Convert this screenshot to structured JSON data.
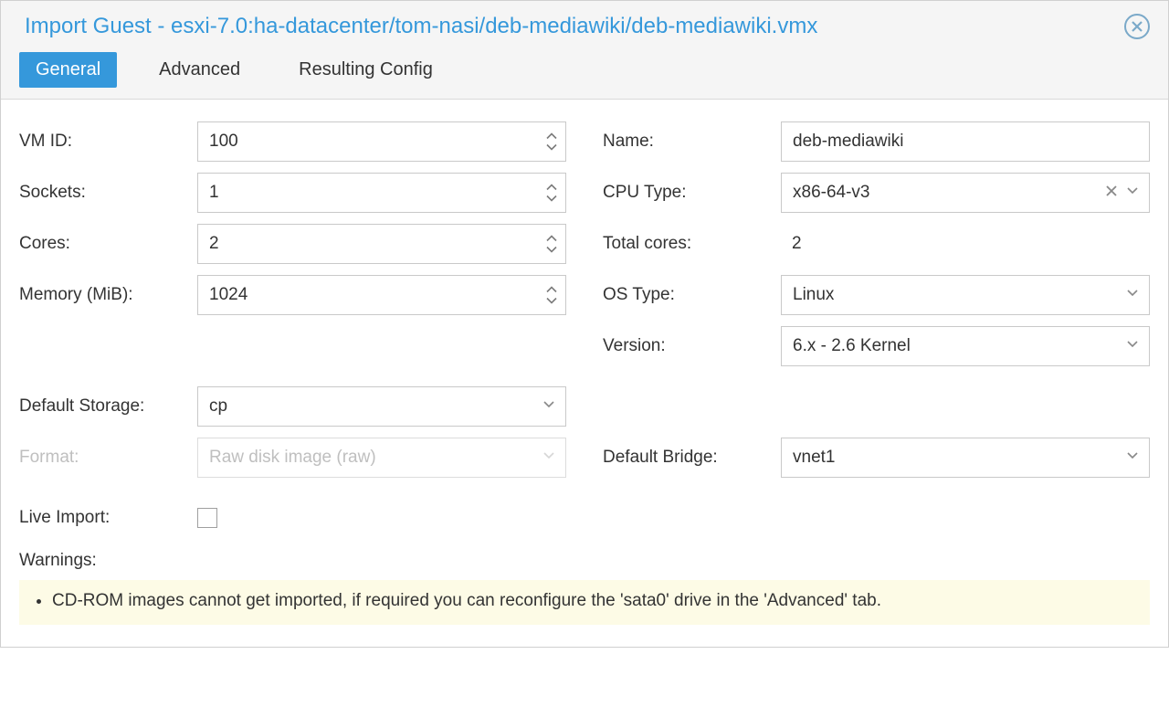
{
  "dialog": {
    "title": "Import Guest - esxi-7.0:ha-datacenter/tom-nasi/deb-mediawiki/deb-mediawiki.vmx"
  },
  "tabs": {
    "general": "General",
    "advanced": "Advanced",
    "resulting": "Resulting Config"
  },
  "labels": {
    "vmid": "VM ID:",
    "sockets": "Sockets:",
    "cores": "Cores:",
    "memory": "Memory (MiB):",
    "name": "Name:",
    "cputype": "CPU Type:",
    "totalcores": "Total cores:",
    "ostype": "OS Type:",
    "version": "Version:",
    "defstorage": "Default Storage:",
    "format": "Format:",
    "defbridge": "Default Bridge:",
    "liveimport": "Live Import:",
    "warnings": "Warnings:"
  },
  "values": {
    "vmid": "100",
    "sockets": "1",
    "cores": "2",
    "memory": "1024",
    "name": "deb-mediawiki",
    "cputype": "x86-64-v3",
    "totalcores": "2",
    "ostype": "Linux",
    "version": "6.x - 2.6 Kernel",
    "defstorage": "cp",
    "format": "Raw disk image (raw)",
    "defbridge": "vnet1"
  },
  "warnings": [
    "CD-ROM images cannot get imported, if required you can reconfigure the 'sata0' drive in the 'Advanced' tab."
  ]
}
